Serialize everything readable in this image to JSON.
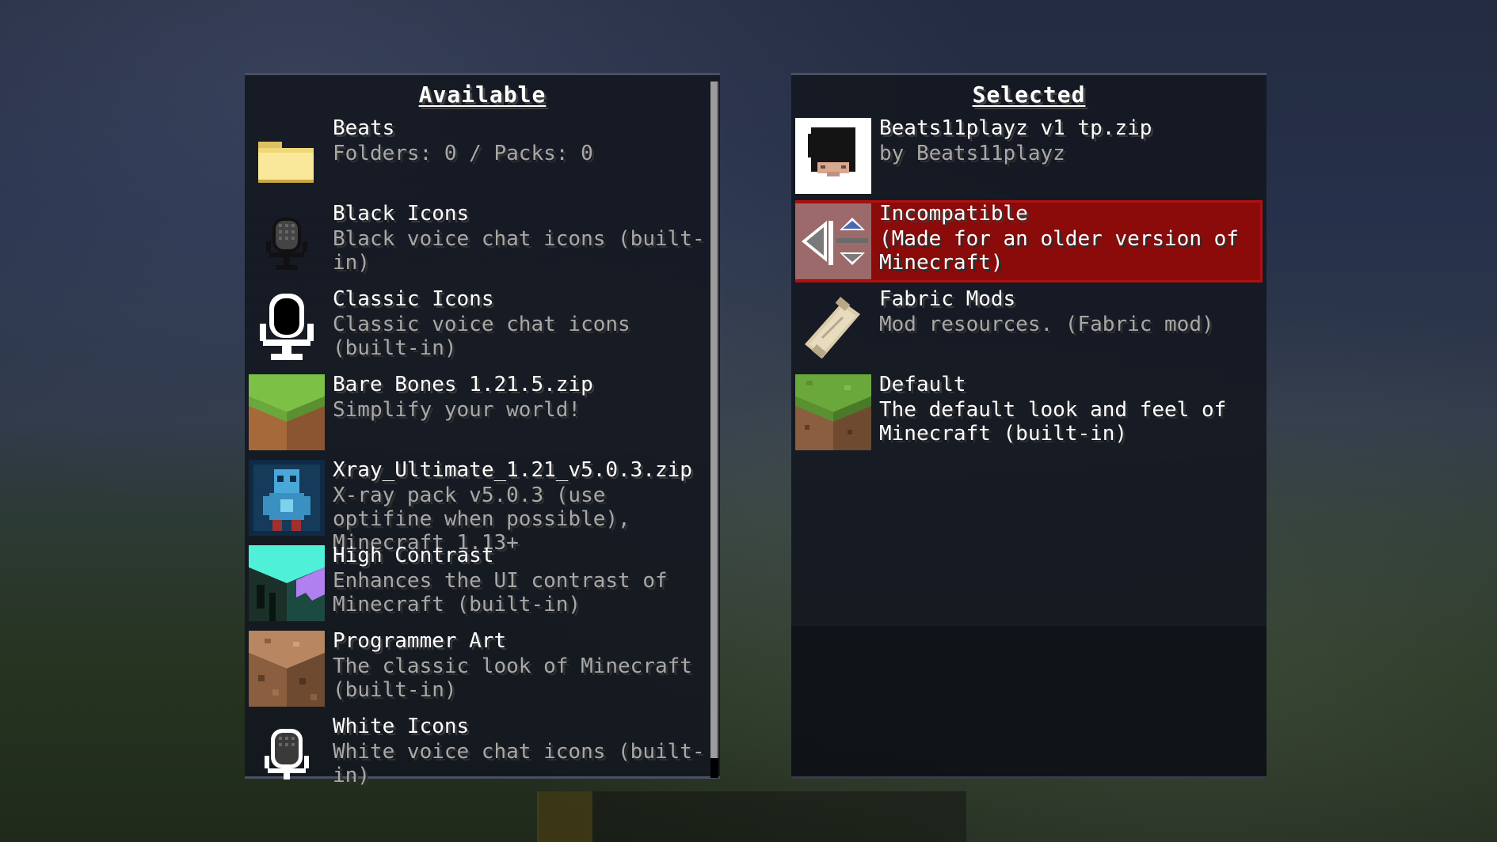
{
  "colors": {
    "incompatible_bg": "#8b0a0a",
    "panel_bg": "#14181f",
    "title": "#ffffff",
    "desc": "#a8a8a8"
  },
  "available": {
    "title": "Available",
    "packs": [
      {
        "name": "Beats",
        "description": "Folders: 0 / Packs: 0",
        "icon": "folder-icon"
      },
      {
        "name": "Black Icons",
        "description": "Black voice chat icons (built-in)",
        "icon": "black-microphone-icon"
      },
      {
        "name": "Classic Icons",
        "description": "Classic voice chat icons (built-in)",
        "icon": "classic-microphone-icon"
      },
      {
        "name": "Bare Bones 1.21.5.zip",
        "description": "Simplify your world!",
        "icon": "grass-block-icon"
      },
      {
        "name": "Xray_Ultimate_1.21_v5.0.3.zip",
        "description": "X-ray pack v5.0.3 (use optifine when possible), Minecraft 1.13+",
        "icon": "xray-creeper-icon"
      },
      {
        "name": "High Contrast",
        "description": "Enhances the UI contrast of Minecraft (built-in)",
        "icon": "high-contrast-icon"
      },
      {
        "name": "Programmer Art",
        "description": "The classic look of Minecraft (built-in)",
        "icon": "dirt-block-icon"
      },
      {
        "name": "White Icons",
        "description": "White voice chat icons (built-in)",
        "icon": "white-microphone-icon"
      }
    ]
  },
  "selected": {
    "title": "Selected",
    "packs": [
      {
        "name": "Beats11playz v1 tp.zip",
        "description": "by Beats11playz",
        "icon": "player-head-icon"
      },
      {
        "name": "Incompatible",
        "description": "(Made for an older version of Minecraft)",
        "icon": "move-arrows-icon"
      },
      {
        "name": "Fabric Mods",
        "description": "Mod resources. (Fabric mod)",
        "icon": "scroll-icon"
      },
      {
        "name": "Default",
        "description": "The default look and feel of Minecraft (built-in)",
        "icon": "grass-block-icon"
      }
    ]
  }
}
